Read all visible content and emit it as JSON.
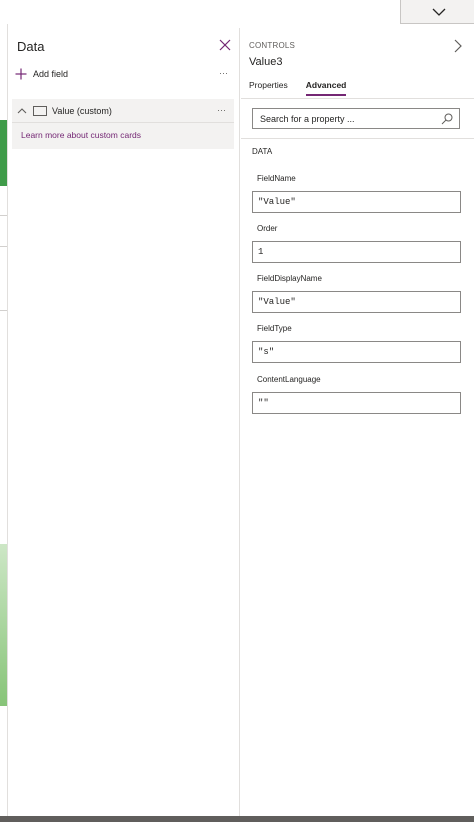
{
  "data_pane": {
    "title": "Data",
    "add_field": "Add field",
    "add_more": "···",
    "field": {
      "label": "Value (custom)",
      "more": "···"
    },
    "learn_link": "Learn more about custom cards"
  },
  "controls_pane": {
    "label": "CONTROLS",
    "name": "Value3",
    "tabs": [
      {
        "label": "Properties",
        "active": false
      },
      {
        "label": "Advanced",
        "active": true
      }
    ],
    "search_placeholder": "Search for a property ...",
    "section": "DATA",
    "properties": [
      {
        "label": "FieldName",
        "value": "\"Value\""
      },
      {
        "label": "Order",
        "value": "1"
      },
      {
        "label": "FieldDisplayName",
        "value": "\"Value\""
      },
      {
        "label": "FieldType",
        "value": "\"s\""
      },
      {
        "label": "ContentLanguage",
        "value": "\"\""
      }
    ]
  },
  "colors": {
    "accent": "#742774",
    "canvas_green": "#3f9b49"
  }
}
